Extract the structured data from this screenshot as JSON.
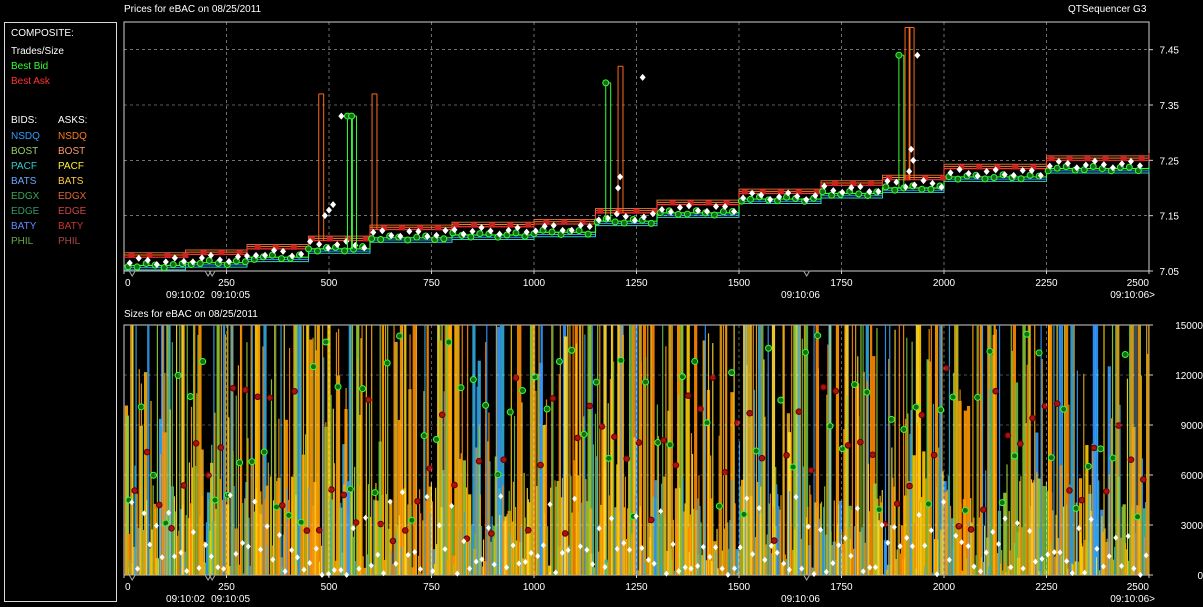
{
  "app": {
    "title": "QTSequencer G3"
  },
  "price_chart": {
    "title": "Prices for  eBAC  on  08/25/2011"
  },
  "size_chart": {
    "title": "Sizes for  eBAC  on  08/25/2011"
  },
  "legend": {
    "composite_header": "COMPOSITE:",
    "composite": [
      {
        "label": "Trades/Size",
        "color": "#ffffff"
      },
      {
        "label": "Best Bid",
        "color": "#33ff33"
      },
      {
        "label": "Best Ask",
        "color": "#ff3333"
      }
    ],
    "bids_header": "BIDS:",
    "asks_header": "ASKS:",
    "exchanges": [
      {
        "bid": "NSDQ",
        "bid_color": "#3399ff",
        "ask": "NSDQ",
        "ask_color": "#ff7a1a"
      },
      {
        "bid": "BOST",
        "bid_color": "#99cc66",
        "ask": "BOST",
        "ask_color": "#ff9966"
      },
      {
        "bid": "PACF",
        "bid_color": "#33cccc",
        "ask": "PACF",
        "ask_color": "#ffee33"
      },
      {
        "bid": "BATS",
        "bid_color": "#66aaff",
        "ask": "BATS",
        "ask_color": "#ffcc44"
      },
      {
        "bid": "EDGX",
        "bid_color": "#33aa55",
        "ask": "EDGX",
        "ask_color": "#dd6633"
      },
      {
        "bid": "EDGE",
        "bid_color": "#339966",
        "ask": "EDGE",
        "ask_color": "#cc4444"
      },
      {
        "bid": "BATY",
        "bid_color": "#6688ff",
        "ask": "BATY",
        "ask_color": "#cc3333"
      },
      {
        "bid": "PHIL",
        "bid_color": "#66aa44",
        "ask": "PHIL",
        "ask_color": "#aa4444"
      }
    ]
  },
  "chart_data": [
    {
      "type": "line",
      "title": "Prices for  eBAC  on  08/25/2011",
      "x_ticks": [
        "0",
        "250",
        "500",
        "750",
        "1000",
        "1250",
        "1500",
        "1750",
        "2000",
        "2250",
        "2500"
      ],
      "x_time_labels": [
        {
          "x": 150,
          "label": "09:10:02"
        },
        {
          "x": 260,
          "label": "09:10:05"
        },
        {
          "x": 1650,
          "label": "09:10:06"
        },
        {
          "x": 2460,
          "label": "09:10:06>"
        }
      ],
      "xlim": [
        0,
        2500
      ],
      "ylim": [
        7.05,
        7.5
      ],
      "y_ticks": [
        "7.05",
        "7.15",
        "7.25",
        "7.35",
        "7.45"
      ],
      "series": [
        {
          "role": "best_bid",
          "color": "#33ff33",
          "points": [
            [
              0,
              7.06
            ],
            [
              150,
              7.065
            ],
            [
              300,
              7.075
            ],
            [
              450,
              7.09
            ],
            [
              560,
              7.09
            ],
            [
              600,
              7.11
            ],
            [
              800,
              7.115
            ],
            [
              1000,
              7.12
            ],
            [
              1150,
              7.14
            ],
            [
              1300,
              7.155
            ],
            [
              1500,
              7.18
            ],
            [
              1700,
              7.19
            ],
            [
              1850,
              7.2
            ],
            [
              2000,
              7.22
            ],
            [
              2250,
              7.235
            ],
            [
              2500,
              7.24
            ]
          ]
        },
        {
          "role": "best_ask",
          "color": "#ff3333",
          "points": [
            [
              0,
              7.075
            ],
            [
              150,
              7.08
            ],
            [
              300,
              7.09
            ],
            [
              450,
              7.105
            ],
            [
              560,
              7.105
            ],
            [
              600,
              7.125
            ],
            [
              800,
              7.13
            ],
            [
              1000,
              7.135
            ],
            [
              1150,
              7.155
            ],
            [
              1300,
              7.17
            ],
            [
              1500,
              7.19
            ],
            [
              1700,
              7.205
            ],
            [
              1850,
              7.215
            ],
            [
              2000,
              7.235
            ],
            [
              2250,
              7.25
            ],
            [
              2500,
              7.255
            ]
          ]
        }
      ],
      "spikes": [
        {
          "x": 475,
          "y": 7.37,
          "color": "#ff6a1a"
        },
        {
          "x": 545,
          "y": 7.33,
          "color": "#33ff33"
        },
        {
          "x": 555,
          "y": 7.33,
          "color": "#33ff33"
        },
        {
          "x": 605,
          "y": 7.37,
          "color": "#ff6a1a"
        },
        {
          "x": 1175,
          "y": 7.39,
          "color": "#33ff33"
        },
        {
          "x": 1205,
          "y": 7.42,
          "color": "#ff6a1a"
        },
        {
          "x": 1890,
          "y": 7.44,
          "color": "#33ff33"
        },
        {
          "x": 1905,
          "y": 7.49,
          "color": "#ff6a1a"
        },
        {
          "x": 1915,
          "y": 7.49,
          "color": "#ff6a1a"
        }
      ],
      "trades": [
        [
          530,
          7.33
        ],
        [
          510,
          7.17
        ],
        [
          500,
          7.16
        ],
        [
          490,
          7.15
        ],
        [
          1265,
          7.4
        ],
        [
          1210,
          7.22
        ],
        [
          1205,
          7.2
        ],
        [
          1935,
          7.44
        ],
        [
          1920,
          7.27
        ],
        [
          1925,
          7.25
        ],
        [
          1915,
          7.23
        ]
      ]
    },
    {
      "type": "bar",
      "title": "Sizes for  eBAC  on  08/25/2011",
      "x_ticks": [
        "0",
        "250",
        "500",
        "750",
        "1000",
        "1250",
        "1500",
        "1750",
        "2000",
        "2250",
        "2500"
      ],
      "x_time_labels": [
        {
          "x": 150,
          "label": "09:10:02"
        },
        {
          "x": 260,
          "label": "09:10:05"
        },
        {
          "x": 1650,
          "label": "09:10:06"
        },
        {
          "x": 2460,
          "label": "09:10:06>"
        }
      ],
      "xlim": [
        0,
        2500
      ],
      "ylim": [
        0,
        15000
      ],
      "y_ticks": [
        "0",
        "3000",
        "6000",
        "9000",
        "12000",
        "15000"
      ]
    }
  ]
}
